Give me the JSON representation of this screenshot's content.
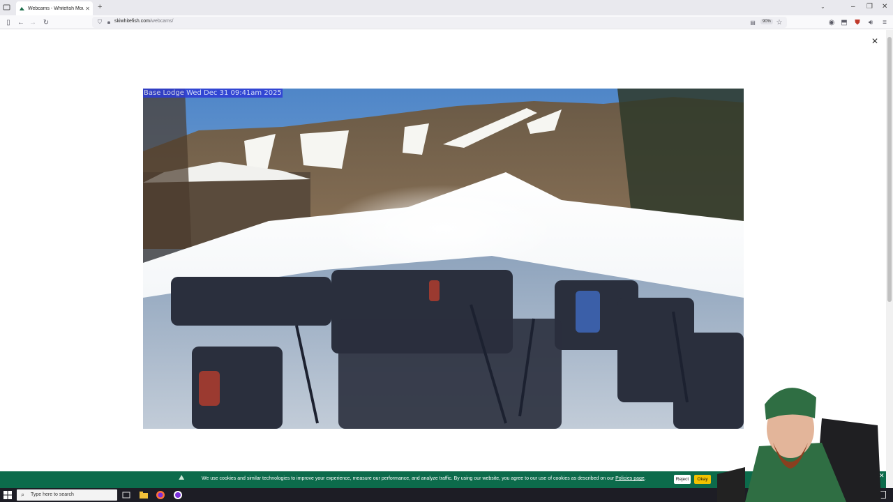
{
  "browser": {
    "tab_title": "Webcams - Whitefish Mountain",
    "url_domain": "skiwhitefish.com",
    "url_path": "/webcams/",
    "zoom": "90%"
  },
  "webcam": {
    "label": "Base Lodge Wed Dec 31 09:41am 2025"
  },
  "cookie_banner": {
    "text": "We use cookies and similar technologies to improve your experience, measure our performance, and analyze traffic. By using our website, you agree to our use of cookies as described on our ",
    "link": "Policies page",
    "text_end": ".",
    "reject_label": "Reject",
    "okay_label": "Okay"
  },
  "taskbar": {
    "search_placeholder": "Type here to search"
  },
  "colors": {
    "cookie_bg": "#0c6b4b",
    "okay_bg": "#f2c200",
    "label_bg": "#2d3bd6"
  }
}
